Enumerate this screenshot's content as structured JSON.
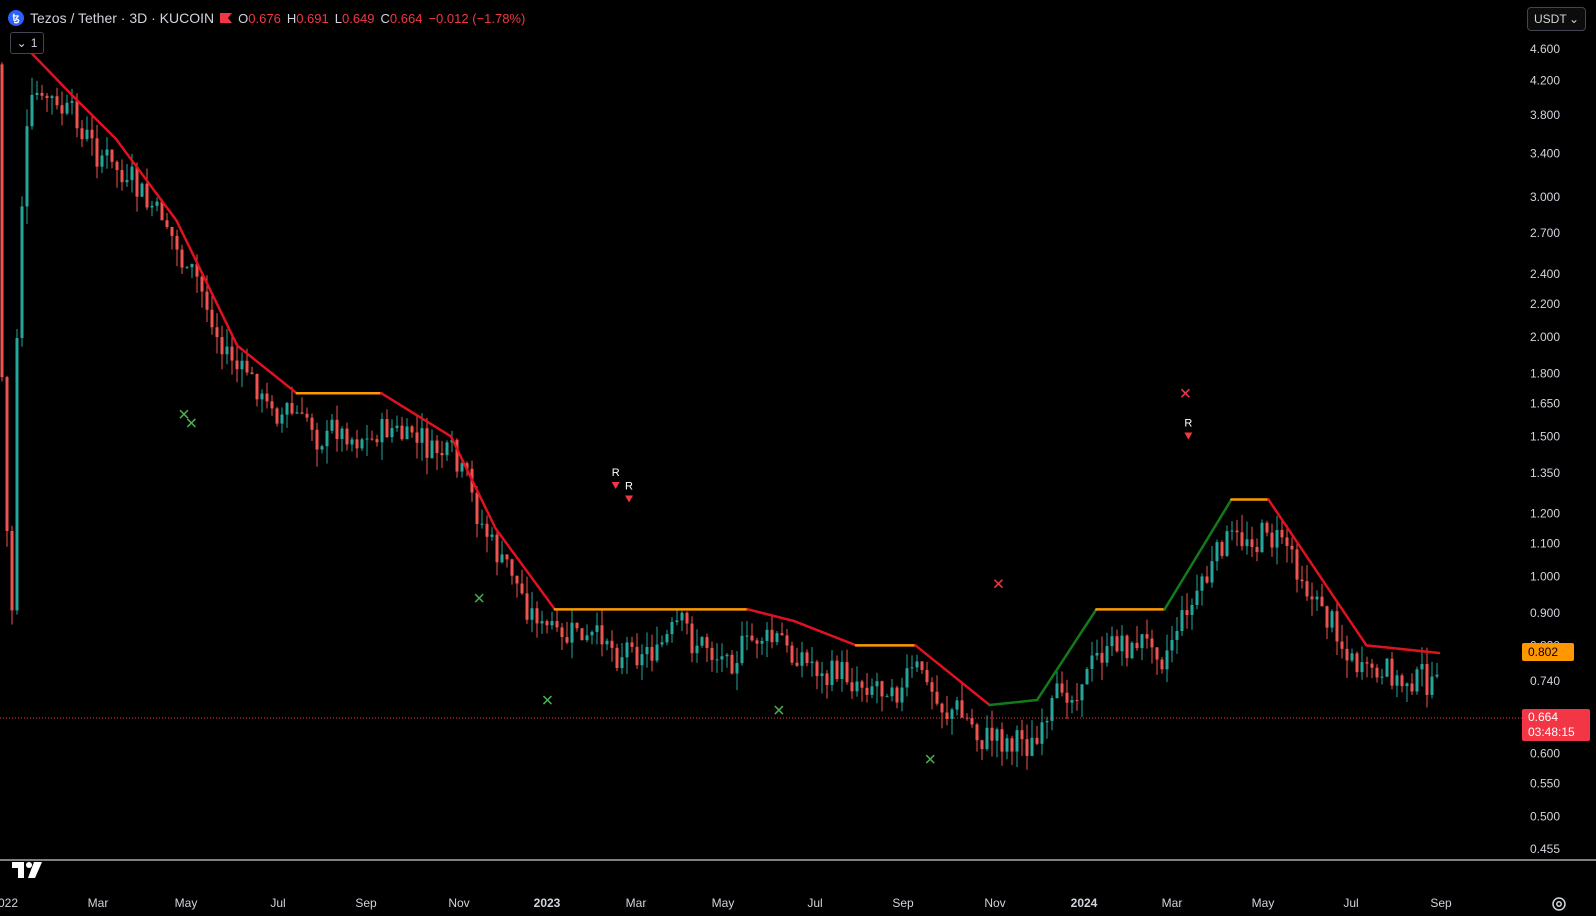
{
  "header": {
    "symbol_title": "Tezos / Tether · 3D · KUCOIN",
    "symbol_icon": "tezos-coin-icon",
    "ohlc": {
      "o_label": "O",
      "o_value": "0.676",
      "h_label": "H",
      "h_value": "0.691",
      "l_label": "L",
      "l_value": "0.649",
      "c_label": "C",
      "c_value": "0.664",
      "change": "−0.012 (−1.78%)"
    },
    "collapse_count": "1",
    "currency": "USDT"
  },
  "price_axis": {
    "labels": [
      "4.600",
      "4.200",
      "3.800",
      "3.400",
      "3.000",
      "2.700",
      "2.400",
      "2.200",
      "2.000",
      "1.800",
      "1.650",
      "1.500",
      "1.350",
      "1.200",
      "1.100",
      "1.000",
      "0.900",
      "0.740",
      "0.600",
      "0.550",
      "0.500",
      "0.455"
    ],
    "partial_label": "0.820",
    "scale": "log"
  },
  "time_axis": {
    "labels": [
      "022",
      "Mar",
      "May",
      "Jul",
      "Sep",
      "Nov",
      "2023",
      "Mar",
      "May",
      "Jul",
      "Sep",
      "Nov",
      "2024",
      "Mar",
      "May",
      "Jul",
      "Sep"
    ],
    "bold_labels": [
      "2023",
      "2024"
    ]
  },
  "badges": {
    "level_value": "0.802",
    "last_price": "0.664",
    "countdown": "03:48:15"
  },
  "markers": {
    "r_label": "R"
  },
  "colors": {
    "up": "#26a69a",
    "down": "#ef5350",
    "line_red": "#e0121f",
    "line_orange": "#ff9800",
    "line_green": "#137a1a",
    "marker_green": "#4caf50",
    "marker_red": "#f23645",
    "last_price_line": "#f23645"
  },
  "chart_data": {
    "type": "candlestick",
    "price_scale": "log",
    "trend_line_points": [
      {
        "date": "2022-01-10",
        "price": 4.8
      },
      {
        "date": "2022-02-20",
        "price": 4.0
      },
      {
        "date": "2022-03-20",
        "price": 3.55
      },
      {
        "date": "2022-04-30",
        "price": 2.8
      },
      {
        "date": "2022-06-10",
        "price": 1.95
      },
      {
        "date": "2022-07-20",
        "price": 1.7
      },
      {
        "date": "2022-09-15",
        "price": 1.7
      },
      {
        "date": "2022-11-01",
        "price": 1.5
      },
      {
        "date": "2022-12-01",
        "price": 1.15
      },
      {
        "date": "2023-01-10",
        "price": 0.91
      },
      {
        "date": "2023-05-20",
        "price": 0.91
      },
      {
        "date": "2023-06-20",
        "price": 0.88
      },
      {
        "date": "2023-08-01",
        "price": 0.82
      },
      {
        "date": "2023-09-10",
        "price": 0.82
      },
      {
        "date": "2023-10-30",
        "price": 0.69
      },
      {
        "date": "2023-12-01",
        "price": 0.7
      },
      {
        "date": "2024-01-10",
        "price": 0.91
      },
      {
        "date": "2024-02-25",
        "price": 0.91
      },
      {
        "date": "2024-04-10",
        "price": 1.25
      },
      {
        "date": "2024-05-05",
        "price": 1.25
      },
      {
        "date": "2024-07-10",
        "price": 0.82
      },
      {
        "date": "2024-08-28",
        "price": 0.802
      }
    ],
    "signal_markers": [
      {
        "type": "x-green",
        "date": "2022-05-05",
        "price": 1.6
      },
      {
        "type": "x-green",
        "date": "2022-05-10",
        "price": 1.56
      },
      {
        "type": "x-green",
        "date": "2022-11-20",
        "price": 0.94
      },
      {
        "type": "x-green",
        "date": "2023-01-05",
        "price": 0.7
      },
      {
        "type": "R-down",
        "date": "2023-02-20",
        "price": 1.3
      },
      {
        "type": "R-down",
        "date": "2023-03-01",
        "price": 1.25
      },
      {
        "type": "x-green",
        "date": "2023-06-10",
        "price": 0.68
      },
      {
        "type": "x-green",
        "date": "2023-09-20",
        "price": 0.59
      },
      {
        "type": "x-red",
        "date": "2023-11-05",
        "price": 0.98
      },
      {
        "type": "x-red",
        "date": "2024-03-10",
        "price": 1.7
      },
      {
        "type": "R-down",
        "date": "2024-03-12",
        "price": 1.5
      }
    ],
    "last_price": 0.664,
    "level": 0.802
  }
}
